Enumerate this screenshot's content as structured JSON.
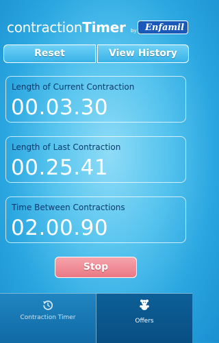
{
  "header": {
    "title_light": "contraction",
    "title_bold": "Timer",
    "by": "by",
    "brand": "Enfamil"
  },
  "toolbar": {
    "reset_label": "Reset",
    "history_label": "View History"
  },
  "panels": [
    {
      "label": "Length of Current Contraction",
      "value": "00.03.30"
    },
    {
      "label": "Length of Last Contraction",
      "value": "00.25.41"
    },
    {
      "label": "Time Between Contractions",
      "value": "02.00.90"
    }
  ],
  "stop_label": "Stop",
  "tabs": [
    {
      "label": "Contraction Timer",
      "icon": "timer-reset-icon",
      "selected": true
    },
    {
      "label": "Offers",
      "icon": "teddy-bear-icon",
      "selected": false
    }
  ],
  "colors": {
    "stop_button": "#ea7984",
    "panel_label": "#083a6b",
    "brand": "#1a59b8"
  }
}
